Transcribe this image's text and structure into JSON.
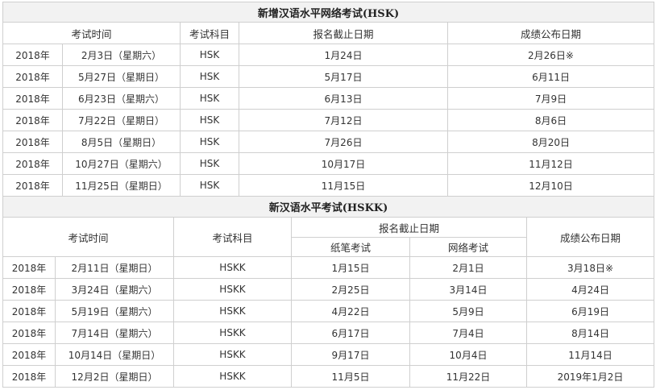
{
  "hsk": {
    "title": "新增汉语水平网络考试(HSK)",
    "headers": {
      "time": "考试时间",
      "subject": "考试科目",
      "deadline": "报名截止日期",
      "result": "成绩公布日期"
    },
    "rows": [
      {
        "year": "2018年",
        "date": "2月3日（星期六）",
        "subject": "HSK",
        "deadline": "1月24日",
        "result": "2月26日※"
      },
      {
        "year": "2018年",
        "date": "5月27日（星期日）",
        "subject": "HSK",
        "deadline": "5月17日",
        "result": "6月11日"
      },
      {
        "year": "2018年",
        "date": "6月23日（星期六）",
        "subject": "HSK",
        "deadline": "6月13日",
        "result": "7月9日"
      },
      {
        "year": "2018年",
        "date": "7月22日（星期日）",
        "subject": "HSK",
        "deadline": "7月12日",
        "result": "8月6日"
      },
      {
        "year": "2018年",
        "date": "8月5日（星期日）",
        "subject": "HSK",
        "deadline": "7月26日",
        "result": "8月20日"
      },
      {
        "year": "2018年",
        "date": "10月27日（星期六）",
        "subject": "HSK",
        "deadline": "10月17日",
        "result": "11月12日"
      },
      {
        "year": "2018年",
        "date": "11月25日（星期日）",
        "subject": "HSK",
        "deadline": "11月15日",
        "result": "12月10日"
      }
    ]
  },
  "hskk": {
    "title": "新汉语水平考试(HSKK)",
    "headers": {
      "time": "考试时间",
      "subject": "考试科目",
      "deadline": "报名截止日期",
      "paper": "纸笔考试",
      "online": "网络考试",
      "result": "成绩公布日期"
    },
    "rows": [
      {
        "year": "2018年",
        "date": "2月11日（星期日）",
        "subject": "HSKK",
        "paper": "1月15日",
        "online": "2月1日",
        "result": "3月18日※"
      },
      {
        "year": "2018年",
        "date": "3月24日（星期六）",
        "subject": "HSKK",
        "paper": "2月25日",
        "online": "3月14日",
        "result": "4月24日"
      },
      {
        "year": "2018年",
        "date": "5月19日（星期六）",
        "subject": "HSKK",
        "paper": "4月22日",
        "online": "5月9日",
        "result": "6月19日"
      },
      {
        "year": "2018年",
        "date": "7月14日（星期六）",
        "subject": "HSKK",
        "paper": "6月17日",
        "online": "7月4日",
        "result": "8月14日"
      },
      {
        "year": "2018年",
        "date": "10月14日（星期日）",
        "subject": "HSKK",
        "paper": "9月17日",
        "online": "10月4日",
        "result": "11月14日"
      },
      {
        "year": "2018年",
        "date": "12月2日（星期日）",
        "subject": "HSKK",
        "paper": "11月5日",
        "online": "11月22日",
        "result": "2019年1月2日"
      }
    ]
  }
}
